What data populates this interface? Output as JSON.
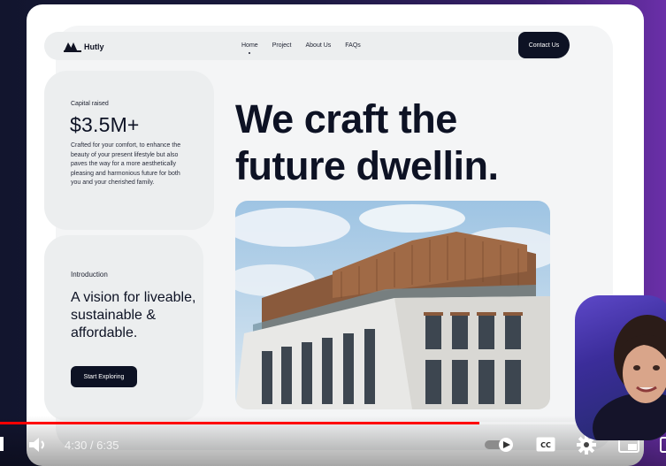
{
  "site": {
    "logo_text": "Hutly",
    "nav": [
      "Home",
      "Project",
      "About Us",
      "FAQs"
    ],
    "contact_button": "Contact Us",
    "capital": {
      "label": "Capital raised",
      "value": "$3.5M+",
      "description": "Crafted for your comfort, to enhance the beauty of your present lifestyle but also paves the way for a more aesthetically pleasing and harmonious future for both you and your cherished family."
    },
    "intro": {
      "label": "Introduction",
      "title": "A vision for liveable, sustainable & affordable.",
      "button": "Start Exploring"
    },
    "hero_title": "We craft the future dwellin."
  },
  "player": {
    "time": "4:30 / 6:35",
    "progress": 0.72,
    "icons": [
      "play-pause-icon",
      "volume-icon",
      "autoplay-toggle-icon",
      "cc-icon",
      "gear-icon",
      "miniplayer-icon",
      "theater-icon"
    ]
  },
  "colors": {
    "accent_dark": "#0d1224",
    "progress_red": "#ff0000",
    "bg_purple": "#6a2fa8"
  }
}
